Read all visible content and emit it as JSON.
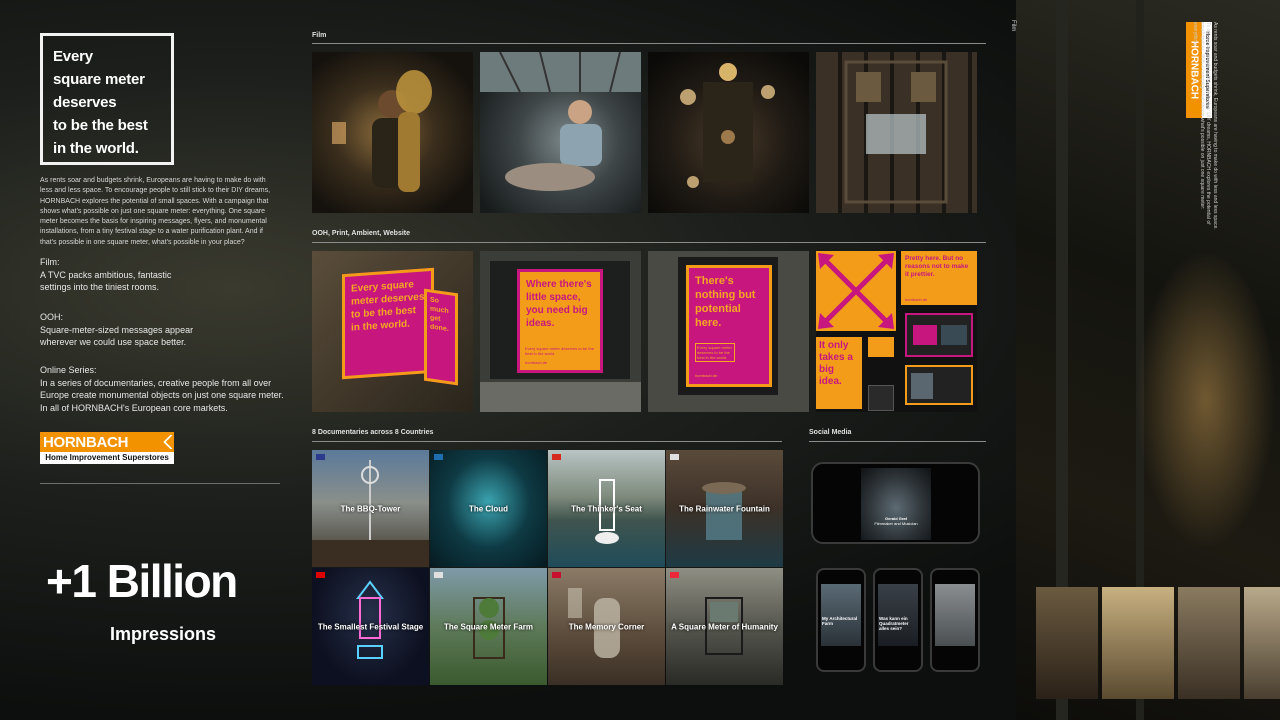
{
  "headline": {
    "lines": [
      "Every",
      "square meter",
      "deserves",
      "to be the best",
      "in the world."
    ]
  },
  "intro_text": "As rents soar and budgets shrink, Europeans are having to make do with less and less space. To encourage people to still stick to their DIY dreams, HORNBACH explores the potential of small spaces. With a campaign that shows what's possible on just one square meter: everything. One square meter becomes the basis for inspiring messages, flyers, and monumental installations, from a tiny festival stage to a water purification plant. And if that's possible in one square meter, what's possible in your place?",
  "film_block": {
    "title": "Film:",
    "lines": [
      "A TVC packs ambitious, fantastic",
      "settings into the tiniest rooms."
    ]
  },
  "ooh_block": {
    "title": "OOH:",
    "lines": [
      "Square-meter-sized messages appear",
      "wherever we could use space better."
    ]
  },
  "online_block": {
    "title": "Online Series:",
    "lines": [
      "In a series of documentaries, creative people from all over",
      "Europe create monumental objects on just one square meter.",
      "In all of HORNBACH's European core markets."
    ]
  },
  "logo": {
    "word": "HORNBACH",
    "tagline": "Home Improvement Superstores"
  },
  "stats": {
    "number": "+1 Billion",
    "label": "Impressions"
  },
  "sections": {
    "film": "Film",
    "ooh": "OOH, Print, Ambient, Website",
    "docs": "8 Documentaries across 8 Countries",
    "social": "Social Media",
    "right_film": "Film"
  },
  "ooh_posters": {
    "p1": "Every square meter deserves to be the best in the world.",
    "p1_side": "So much get done.",
    "p1_url": "hornbach.de",
    "p2": "Where there's little space, you need big ideas.",
    "p2_small": "Every square meter deserves to be the best in the world.",
    "p2_url": "hornbach.de",
    "p3": "There's nothing but potential here.",
    "p3_small": "Every square meter deserves to be the best in the world.",
    "p3_url": "hornbach.de",
    "print1": "Pretty here. But no reasons not to make it prettier.",
    "print1_url": "hornbach.de",
    "print2": "It only takes a big idea."
  },
  "documentaries": [
    {
      "title": "The BBQ-Tower",
      "flag": "#2b3a8c"
    },
    {
      "title": "The Cloud",
      "flag": "#1f6fb0"
    },
    {
      "title": "The Thinker's Seat",
      "flag": "#d52b1e"
    },
    {
      "title": "The Rainwater Fountain",
      "flag": "#e0e0e0"
    },
    {
      "title": "The Smallest Festival Stage",
      "flag": "#dd0000"
    },
    {
      "title": "The Square Meter Farm",
      "flag": "#e0e0e0"
    },
    {
      "title": "The Memory Corner",
      "flag": "#c8102e"
    },
    {
      "title": "A Square Meter of Humanity",
      "flag": "#ed2939"
    }
  ],
  "social": {
    "video_caption_name": "Gerald Graf",
    "video_caption_sub": "Filmmaker and Musician",
    "post1": "My Architectural Farm",
    "post2": "Was kann ein Quadratmeter alles sein?",
    "post3": ""
  },
  "right_panel": {
    "logo_word": "HORNBACH",
    "logo_tagline": "Home Improvement Superstores",
    "text": "As rents soar and budgets shrink, Europeans are having to make do with less and less space. To encourage people to still stick to their DIY dreams, HORNBACH explores the potential of small spaces. With a campaign that shows what's possible on just one square meter: everything."
  },
  "colors": {
    "orange": "#f39200",
    "magenta": "#c7177e",
    "poster_orange": "#f39c1a"
  }
}
